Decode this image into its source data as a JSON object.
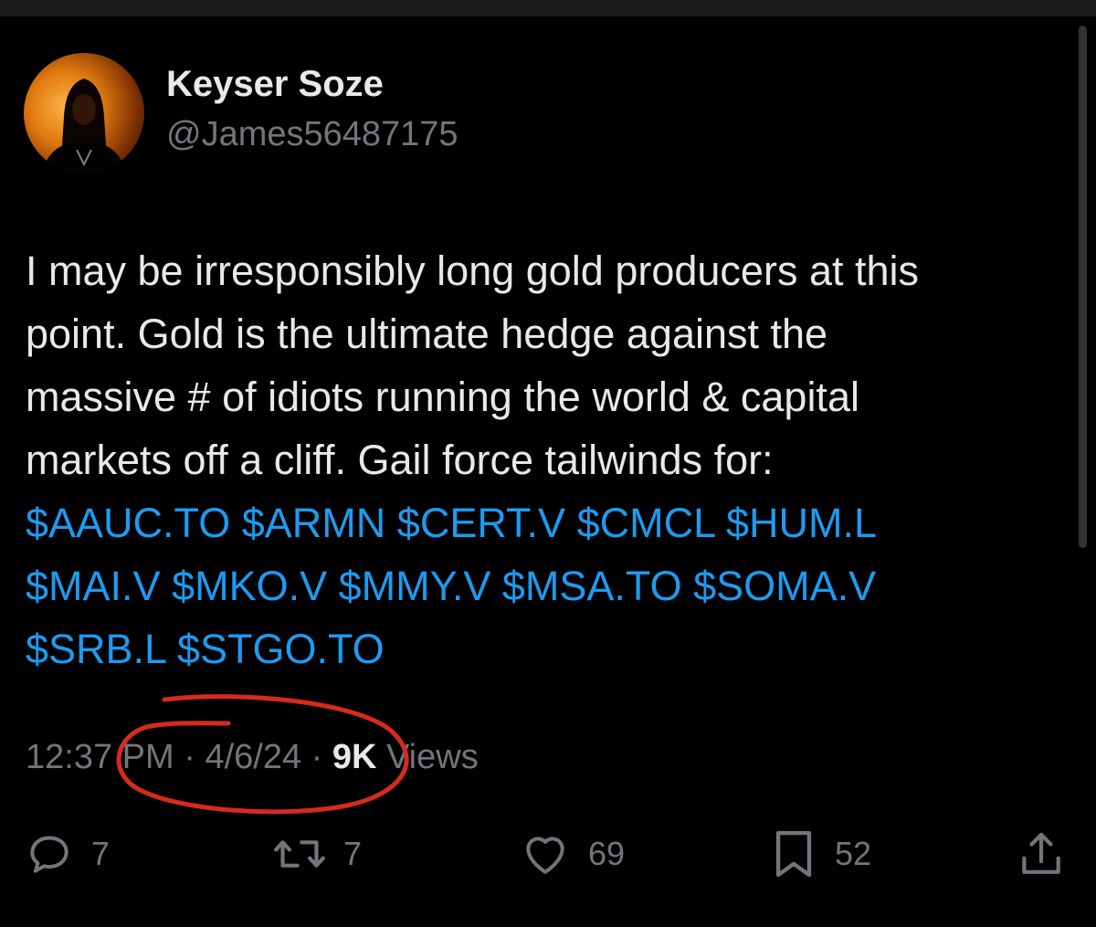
{
  "author": {
    "display_name": "Keyser Soze",
    "handle": "@James56487175",
    "avatar_icon": "profile-photo"
  },
  "tweet": {
    "lines": [
      "I may be irresponsibly long gold producers at this",
      "point. Gold is the ultimate hedge against the",
      "massive # of idiots running the world & capital",
      "markets off a cliff. Gail force tailwinds for:"
    ],
    "cashtag_lines": [
      [
        "$AAUC.TO",
        "$ARMN",
        "$CERT.V",
        "$CMCL",
        "$HUM.L"
      ],
      [
        "$MAI.V",
        "$MKO.V",
        "$MMY.V",
        "$MSA.TO",
        "$SOMA.V"
      ],
      [
        "$SRB.L",
        "$STGO.TO"
      ]
    ]
  },
  "meta": {
    "time": "12:37 PM",
    "separator": "·",
    "date": "4/6/24",
    "views_count": "9K",
    "views_label": "Views"
  },
  "actions": {
    "reply": {
      "icon": "reply-icon",
      "count": "7"
    },
    "repost": {
      "icon": "repost-icon",
      "count": "7"
    },
    "like": {
      "icon": "heart-icon",
      "count": "69"
    },
    "bookmark": {
      "icon": "bookmark-icon",
      "count": "52"
    },
    "share": {
      "icon": "share-icon"
    }
  },
  "colors": {
    "background": "#000000",
    "text": "#e7e9ea",
    "secondary_text": "#71767b",
    "link": "#1d9bf0",
    "annotation": "#d62a1e"
  }
}
